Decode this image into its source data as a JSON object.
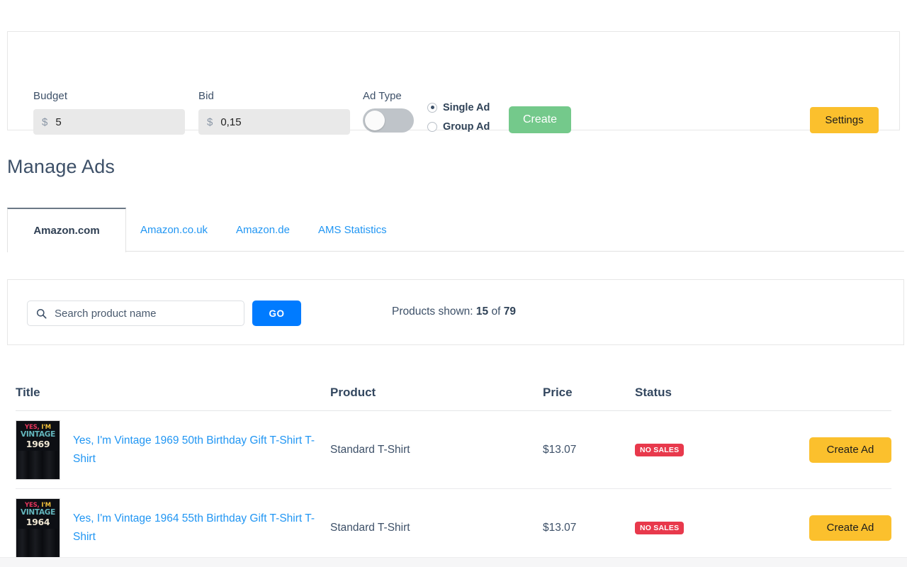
{
  "settings_panel": {
    "budget": {
      "label": "Budget",
      "currency": "$",
      "value": "5"
    },
    "bid": {
      "label": "Bid",
      "currency": "$",
      "value": "0,15"
    },
    "ad_type": {
      "label": "Ad Type",
      "toggle_state": "off"
    },
    "radios": [
      {
        "label": "Single Ad",
        "selected": true
      },
      {
        "label": "Group Ad",
        "selected": false
      }
    ],
    "create_label": "Create",
    "settings_label": "Settings",
    "create_color": "#74c98b",
    "settings_color": "#fbc02d"
  },
  "page_title": "Manage Ads",
  "tabs": [
    {
      "label": "Amazon.com",
      "active": true
    },
    {
      "label": "Amazon.co.uk",
      "active": false
    },
    {
      "label": "Amazon.de",
      "active": false
    },
    {
      "label": "AMS Statistics",
      "active": false
    }
  ],
  "search": {
    "icon": "search-icon",
    "placeholder": "Search product name",
    "value": "",
    "go_label": "GO",
    "go_color": "#007bff",
    "count_prefix": "Products shown: ",
    "count_shown": "15",
    "count_middle": " of ",
    "count_total": "79"
  },
  "table": {
    "headers": {
      "title": "Title",
      "product": "Product",
      "price": "Price",
      "status": "Status",
      "action": ""
    },
    "rows": [
      {
        "thumb": {
          "line1_a": "YES,",
          "line1_b": " I'M",
          "line2": "VINTAGE",
          "line3": "1969"
        },
        "title": "Yes, I'm Vintage 1969 50th Birthday Gift T-Shirt T-Shirt",
        "product": "Standard T-Shirt",
        "price": "$13.07",
        "status": "NO SALES",
        "status_color": "#e8394c",
        "action_label": "Create Ad"
      },
      {
        "thumb": {
          "line1_a": "YES,",
          "line1_b": " I'M",
          "line2": "VINTAGE",
          "line3": "1964"
        },
        "title": "Yes, I'm Vintage 1964 55th Birthday Gift T-Shirt T-Shirt",
        "product": "Standard T-Shirt",
        "price": "$13.07",
        "status": "NO SALES",
        "status_color": "#e8394c",
        "action_label": "Create Ad"
      }
    ]
  }
}
